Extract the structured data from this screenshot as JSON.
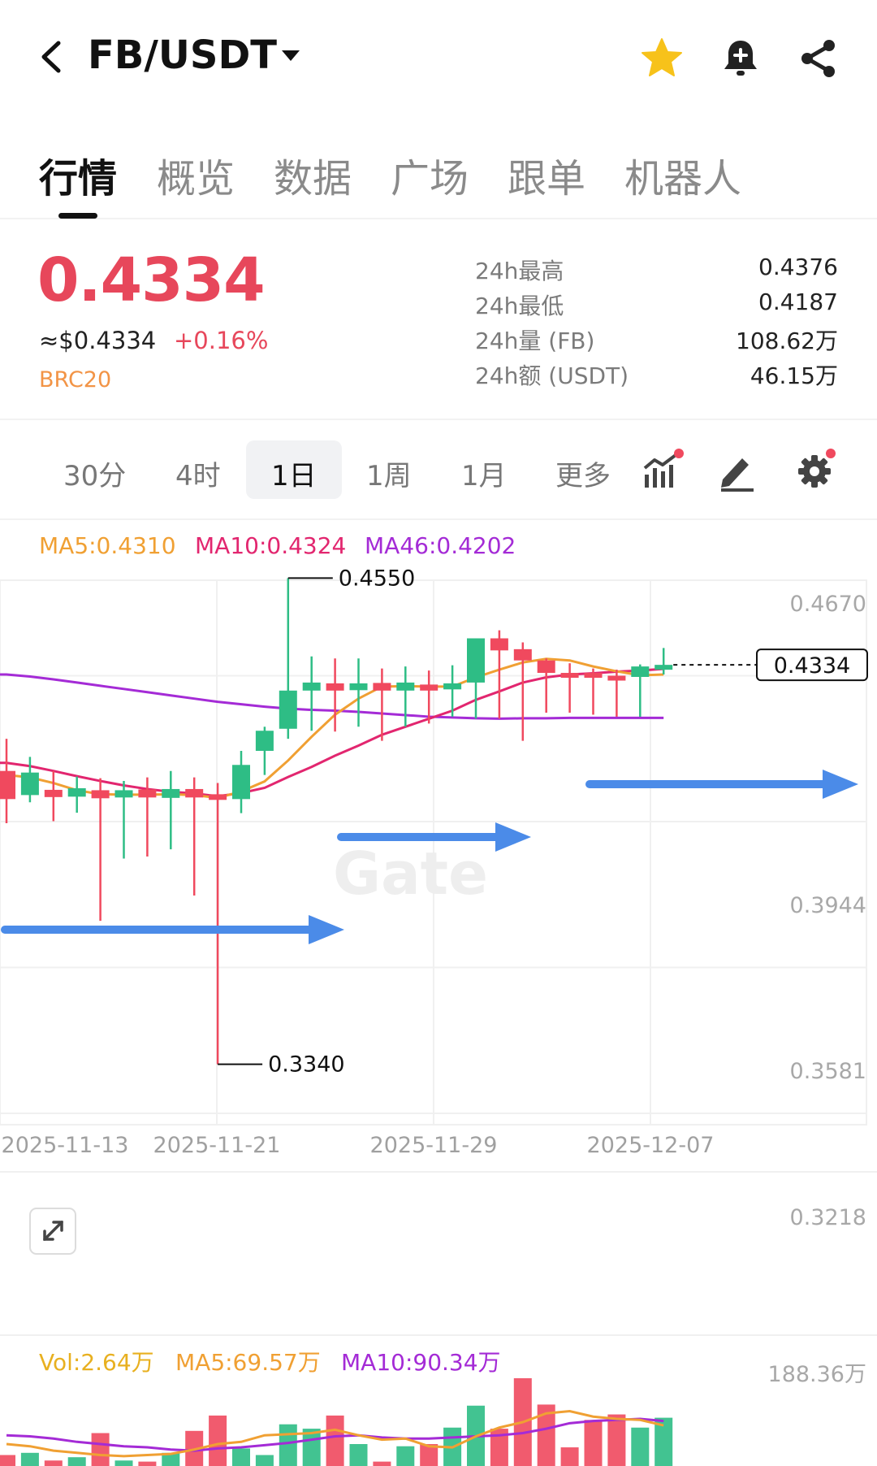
{
  "header": {
    "pair": "FB/USDT",
    "icons": [
      "back-arrow-icon",
      "star-icon",
      "price-alert-bell-icon",
      "share-icon"
    ]
  },
  "tabs": [
    {
      "label": "行情",
      "active": true
    },
    {
      "label": "概览"
    },
    {
      "label": "数据"
    },
    {
      "label": "广场"
    },
    {
      "label": "跟单"
    },
    {
      "label": "机器人"
    }
  ],
  "ticker": {
    "last_price": "0.4334",
    "usd_price": "≈$0.4334",
    "change_pct": "+0.16%",
    "chain_tag": "BRC20",
    "stats": [
      {
        "label": "24h最高",
        "value": "0.4376"
      },
      {
        "label": "24h最低",
        "value": "0.4187"
      },
      {
        "label": "24h量 (FB)",
        "value": "108.62万"
      },
      {
        "label": "24h额 (USDT)",
        "value": "46.15万"
      }
    ]
  },
  "periods": [
    {
      "label": "30分"
    },
    {
      "label": "4时"
    },
    {
      "label": "1日",
      "active": true
    },
    {
      "label": "1周"
    },
    {
      "label": "1月"
    },
    {
      "label": "更多"
    }
  ],
  "chart_tools": [
    "indicators-icon",
    "draw-tool-icon",
    "settings-icon"
  ],
  "ma_legend": {
    "ma5": "MA5:0.4310",
    "ma10": "MA10:0.4324",
    "ma46": "MA46:0.4202"
  },
  "vol_legend": {
    "vol": "Vol:2.64万",
    "ma5": "MA5:69.57万",
    "ma10": "MA10:90.34万"
  },
  "colors": {
    "up": "#2ebd85",
    "down": "#f0495e",
    "ma5": "#f0a033",
    "ma10": "#e2266f",
    "ma46": "#a42bd6",
    "annotation_arrow": "#4b8be8",
    "chain_tag": "#f29446"
  },
  "chart_data": {
    "type": "candlestick",
    "y_ticks": [
      "0.4670",
      "0.3944",
      "0.3581",
      "0.3218"
    ],
    "ylim": [
      0.3218,
      0.467
    ],
    "x_ticks": [
      "2025-11-13",
      "2025-11-21",
      "2025-11-29",
      "2025-12-07"
    ],
    "max_label": "0.4550",
    "min_label": "0.3340",
    "last_label": "0.4334",
    "watermark": "Gate",
    "candles": [
      {
        "o": 0.407,
        "h": 0.415,
        "c": 0.4,
        "l": 0.394
      },
      {
        "o": 0.401,
        "h": 0.4105,
        "c": 0.4066,
        "l": 0.3992
      },
      {
        "o": 0.4023,
        "h": 0.407,
        "c": 0.4005,
        "l": 0.3945
      },
      {
        "o": 0.4006,
        "h": 0.4056,
        "c": 0.4027,
        "l": 0.3966
      },
      {
        "o": 0.4022,
        "h": 0.4052,
        "c": 0.4002,
        "l": 0.3697
      },
      {
        "o": 0.4004,
        "h": 0.4045,
        "c": 0.4022,
        "l": 0.3852
      },
      {
        "o": 0.4024,
        "h": 0.4054,
        "c": 0.4004,
        "l": 0.3857
      },
      {
        "o": 0.4003,
        "h": 0.407,
        "c": 0.4025,
        "l": 0.3875
      },
      {
        "o": 0.4025,
        "h": 0.4054,
        "c": 0.4004,
        "l": 0.376
      },
      {
        "o": 0.4012,
        "h": 0.404,
        "c": 0.3998,
        "l": 0.334
      },
      {
        "o": 0.4,
        "h": 0.412,
        "c": 0.4085,
        "l": 0.3965
      },
      {
        "o": 0.412,
        "h": 0.418,
        "c": 0.417,
        "l": 0.406
      },
      {
        "o": 0.4175,
        "h": 0.455,
        "c": 0.427,
        "l": 0.415
      },
      {
        "o": 0.427,
        "h": 0.4355,
        "c": 0.429,
        "l": 0.417
      },
      {
        "o": 0.4288,
        "h": 0.435,
        "c": 0.427,
        "l": 0.4168
      },
      {
        "o": 0.4271,
        "h": 0.435,
        "c": 0.4288,
        "l": 0.418
      },
      {
        "o": 0.4289,
        "h": 0.4325,
        "c": 0.427,
        "l": 0.4145
      },
      {
        "o": 0.427,
        "h": 0.433,
        "c": 0.429,
        "l": 0.418
      },
      {
        "o": 0.4285,
        "h": 0.432,
        "c": 0.427,
        "l": 0.4188
      },
      {
        "o": 0.4273,
        "h": 0.4333,
        "c": 0.4288,
        "l": 0.4205
      },
      {
        "o": 0.429,
        "h": 0.44,
        "c": 0.44,
        "l": 0.42
      },
      {
        "o": 0.44,
        "h": 0.442,
        "c": 0.437,
        "l": 0.42
      },
      {
        "o": 0.4373,
        "h": 0.439,
        "c": 0.4345,
        "l": 0.4145
      },
      {
        "o": 0.4345,
        "h": 0.435,
        "c": 0.4314,
        "l": 0.4215
      },
      {
        "o": 0.4314,
        "h": 0.4338,
        "c": 0.4304,
        "l": 0.4215
      },
      {
        "o": 0.4314,
        "h": 0.4325,
        "c": 0.4307,
        "l": 0.421
      },
      {
        "o": 0.4307,
        "h": 0.4322,
        "c": 0.4304,
        "l": 0.4205
      },
      {
        "o": 0.4304,
        "h": 0.4335,
        "c": 0.433,
        "l": 0.4205
      },
      {
        "o": 0.433,
        "h": 0.4376,
        "c": 0.4334,
        "l": 0.431
      }
    ],
    "ma5": [
      0.406,
      0.4054,
      0.404,
      0.4022,
      0.4012,
      0.4011,
      0.4011,
      0.4012,
      0.401,
      0.4003,
      0.4019,
      0.4044,
      0.4096,
      0.4155,
      0.421,
      0.425,
      0.428,
      0.4281,
      0.428,
      0.428,
      0.4303,
      0.4322,
      0.434,
      0.4349,
      0.4345,
      0.433,
      0.4318,
      0.4308,
      0.431
    ],
    "ma10": [
      0.409,
      0.4082,
      0.407,
      0.4057,
      0.4045,
      0.4034,
      0.4025,
      0.4018,
      0.4014,
      0.4007,
      0.4015,
      0.4028,
      0.4055,
      0.408,
      0.4108,
      0.4133,
      0.416,
      0.418,
      0.42,
      0.422,
      0.4247,
      0.4268,
      0.429,
      0.4303,
      0.431,
      0.4313,
      0.4317,
      0.432,
      0.4324
    ],
    "ma46": [
      0.431,
      0.4305,
      0.4298,
      0.429,
      0.4282,
      0.4274,
      0.4266,
      0.4258,
      0.425,
      0.4242,
      0.4236,
      0.423,
      0.4225,
      0.4222,
      0.422,
      0.4217,
      0.4213,
      0.4209,
      0.4205,
      0.4203,
      0.4201,
      0.42,
      0.4201,
      0.4201,
      0.4202,
      0.4202,
      0.4202,
      0.4202,
      0.4202
    ],
    "volume": {
      "max_label": "188.36万",
      "bars": [
        0.1,
        0.12,
        0.05,
        0.08,
        0.3,
        0.05,
        0.04,
        0.12,
        0.32,
        0.46,
        0.16,
        0.1,
        0.38,
        0.34,
        0.46,
        0.2,
        0.04,
        0.18,
        0.2,
        0.35,
        0.55,
        0.34,
        0.8,
        0.56,
        0.17,
        0.42,
        0.47,
        0.35,
        0.44
      ],
      "ma5": [
        0.2,
        0.18,
        0.14,
        0.12,
        0.1,
        0.09,
        0.1,
        0.11,
        0.15,
        0.2,
        0.22,
        0.28,
        0.29,
        0.3,
        0.33,
        0.28,
        0.24,
        0.25,
        0.18,
        0.17,
        0.27,
        0.35,
        0.4,
        0.48,
        0.5,
        0.45,
        0.43,
        0.42,
        0.37
      ],
      "ma10": [
        0.28,
        0.27,
        0.25,
        0.22,
        0.2,
        0.18,
        0.17,
        0.15,
        0.14,
        0.16,
        0.17,
        0.19,
        0.21,
        0.24,
        0.27,
        0.28,
        0.26,
        0.25,
        0.25,
        0.26,
        0.27,
        0.28,
        0.3,
        0.34,
        0.39,
        0.41,
        0.42,
        0.43,
        0.41
      ]
    }
  }
}
